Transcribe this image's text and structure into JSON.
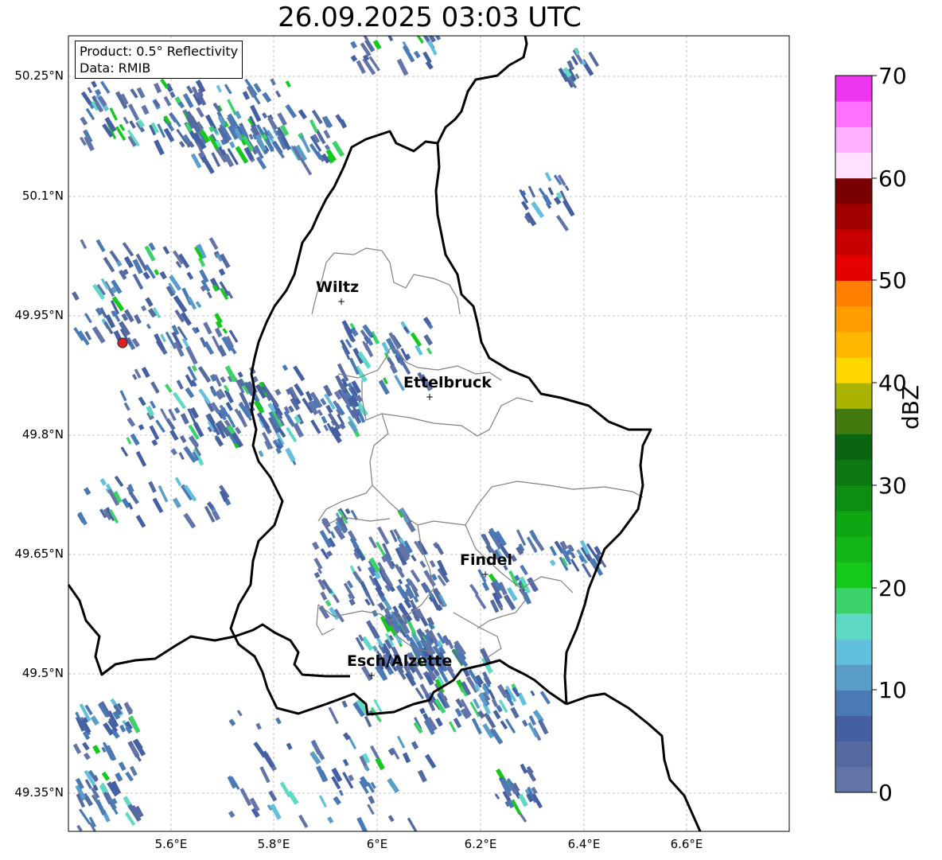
{
  "title": "26.09.2025 03:03 UTC",
  "info": {
    "product": "Product: 0.5° Reflectivity",
    "data": "Data: RMIB"
  },
  "latitude_labels": [
    "50.25°N",
    "50.1°N",
    "49.95°N",
    "49.8°N",
    "49.65°N",
    "49.5°N",
    "49.35°N"
  ],
  "longitude_labels": [
    "5.6°E",
    "5.8°E",
    "6°E",
    "6.2°E",
    "6.4°E",
    "6.6°E"
  ],
  "cities": [
    {
      "name": "Wiltz"
    },
    {
      "name": "Ettelbruck"
    },
    {
      "name": "Findel"
    },
    {
      "name": "Esch/Alzette"
    }
  ],
  "colorbar": {
    "label": "dBZ",
    "ticks": [
      "0",
      "10",
      "20",
      "30",
      "40",
      "50",
      "60",
      "70"
    ],
    "step_dbz": 2.5,
    "colors": [
      "#6374a8",
      "#546aa0",
      "#4460a3",
      "#4a7ab5",
      "#5a9ec8",
      "#63c0dc",
      "#5fd8c4",
      "#3cd26a",
      "#15c81c",
      "#13b618",
      "#10a512",
      "#0d8e12",
      "#0b7814",
      "#0a6511",
      "#437a10",
      "#aab300",
      "#ffd700",
      "#ffb700",
      "#ff9c00",
      "#ff7f00",
      "#e50000",
      "#c60000",
      "#a00000",
      "#780000",
      "#ffe0ff",
      "#ffb0ff",
      "#ff72ff",
      "#ec36f0"
    ]
  }
}
